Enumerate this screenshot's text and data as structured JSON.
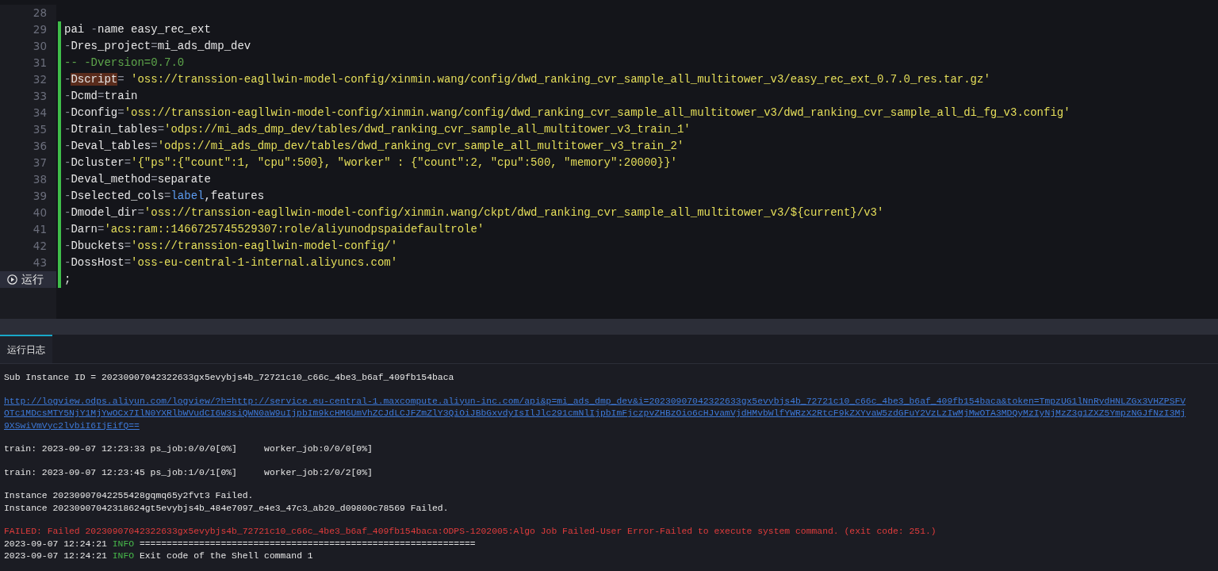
{
  "editor": {
    "lines": [
      {
        "kind": "numbered",
        "number": "28",
        "modified": false
      },
      {
        "kind": "numbered",
        "number": "29",
        "modified": true,
        "tokens": [
          {
            "kind": "plain",
            "text": "pai "
          },
          {
            "kind": "op",
            "text": "-"
          },
          {
            "kind": "plain",
            "text": "name easy_rec_ext"
          }
        ]
      },
      {
        "kind": "numbered",
        "number": "30",
        "modified": true,
        "tokens": [
          {
            "kind": "op",
            "text": "-"
          },
          {
            "kind": "plain",
            "text": "Dres_project"
          },
          {
            "kind": "op",
            "text": "="
          },
          {
            "kind": "plain",
            "text": "mi_ads_dmp_dev"
          }
        ]
      },
      {
        "kind": "numbered",
        "number": "31",
        "modified": true,
        "tokens": [
          {
            "kind": "comment",
            "text": "-- -Dversion=0.7.0"
          }
        ]
      },
      {
        "kind": "numbered",
        "number": "32",
        "modified": true,
        "tokens": [
          {
            "kind": "op",
            "text": "-"
          },
          {
            "kind": "highlight",
            "text": "Dscript"
          },
          {
            "kind": "op",
            "text": "= "
          },
          {
            "kind": "string",
            "text": "'oss://transsion-eagllwin-model-config/xinmin.wang/config/dwd_ranking_cvr_sample_all_multitower_v3/easy_rec_ext_0.7.0_res.tar.gz'"
          }
        ]
      },
      {
        "kind": "numbered",
        "number": "33",
        "modified": true,
        "tokens": [
          {
            "kind": "op",
            "text": "-"
          },
          {
            "kind": "plain",
            "text": "Dcmd"
          },
          {
            "kind": "op",
            "text": "="
          },
          {
            "kind": "plain",
            "text": "train"
          }
        ]
      },
      {
        "kind": "numbered",
        "number": "34",
        "modified": true,
        "tokens": [
          {
            "kind": "op",
            "text": "-"
          },
          {
            "kind": "plain",
            "text": "Dconfig"
          },
          {
            "kind": "op",
            "text": "="
          },
          {
            "kind": "string",
            "text": "'oss://transsion-eagllwin-model-config/xinmin.wang/config/dwd_ranking_cvr_sample_all_multitower_v3/dwd_ranking_cvr_sample_all_di_fg_v3.config'"
          }
        ]
      },
      {
        "kind": "numbered",
        "number": "35",
        "modified": true,
        "tokens": [
          {
            "kind": "op",
            "text": "-"
          },
          {
            "kind": "plain",
            "text": "Dtrain_tables"
          },
          {
            "kind": "op",
            "text": "="
          },
          {
            "kind": "string",
            "text": "'odps://mi_ads_dmp_dev/tables/dwd_ranking_cvr_sample_all_multitower_v3_train_1'"
          }
        ]
      },
      {
        "kind": "numbered",
        "number": "36",
        "modified": true,
        "tokens": [
          {
            "kind": "op",
            "text": "-"
          },
          {
            "kind": "plain",
            "text": "Deval_tables"
          },
          {
            "kind": "op",
            "text": "="
          },
          {
            "kind": "string",
            "text": "'odps://mi_ads_dmp_dev/tables/dwd_ranking_cvr_sample_all_multitower_v3_train_2'"
          }
        ]
      },
      {
        "kind": "numbered",
        "number": "37",
        "modified": true,
        "tokens": [
          {
            "kind": "op",
            "text": "-"
          },
          {
            "kind": "plain",
            "text": "Dcluster"
          },
          {
            "kind": "op",
            "text": "="
          },
          {
            "kind": "string",
            "text": "'{\"ps\":{\"count\":1, \"cpu\":500}, \"worker\" : {\"count\":2, \"cpu\":500, \"memory\":20000}}'"
          }
        ]
      },
      {
        "kind": "numbered",
        "number": "38",
        "modified": true,
        "tokens": [
          {
            "kind": "op",
            "text": "-"
          },
          {
            "kind": "plain",
            "text": "Deval_method"
          },
          {
            "kind": "op",
            "text": "="
          },
          {
            "kind": "plain",
            "text": "separate"
          }
        ]
      },
      {
        "kind": "numbered",
        "number": "39",
        "modified": true,
        "tokens": [
          {
            "kind": "op",
            "text": "-"
          },
          {
            "kind": "plain",
            "text": "Dselected_cols"
          },
          {
            "kind": "op",
            "text": "="
          },
          {
            "kind": "keyword",
            "text": "label"
          },
          {
            "kind": "plain",
            "text": ",features"
          }
        ]
      },
      {
        "kind": "numbered",
        "number": "40",
        "modified": true,
        "tokens": [
          {
            "kind": "op",
            "text": "-"
          },
          {
            "kind": "plain",
            "text": "Dmodel_dir"
          },
          {
            "kind": "op",
            "text": "="
          },
          {
            "kind": "string",
            "text": "'oss://transsion-eagllwin-model-config/xinmin.wang/ckpt/dwd_ranking_cvr_sample_all_multitower_v3/${current}/v3'"
          }
        ]
      },
      {
        "kind": "numbered",
        "number": "41",
        "modified": true,
        "tokens": [
          {
            "kind": "op",
            "text": "-"
          },
          {
            "kind": "plain",
            "text": "Darn"
          },
          {
            "kind": "op",
            "text": "="
          },
          {
            "kind": "string",
            "text": "'acs:ram::1466725745529307:role/aliyunodpspaidefaultrole'"
          }
        ]
      },
      {
        "kind": "numbered",
        "number": "42",
        "modified": true,
        "tokens": [
          {
            "kind": "op",
            "text": "-"
          },
          {
            "kind": "plain",
            "text": "Dbuckets"
          },
          {
            "kind": "op",
            "text": "="
          },
          {
            "kind": "string",
            "text": "'oss://transsion-eagllwin-model-config/'"
          }
        ]
      },
      {
        "kind": "numbered",
        "number": "43",
        "modified": true,
        "tokens": [
          {
            "kind": "op",
            "text": "-"
          },
          {
            "kind": "plain",
            "text": "DossHost"
          },
          {
            "kind": "op",
            "text": "="
          },
          {
            "kind": "string",
            "text": "'oss-eu-central-1-internal.aliyuncs.com'"
          }
        ]
      },
      {
        "kind": "run",
        "label": "运行",
        "modified": true,
        "tokens": [
          {
            "kind": "plain",
            "text": ";"
          }
        ]
      }
    ]
  },
  "log_panel": {
    "tabs": [
      {
        "label": "运行日志",
        "selected": true
      }
    ],
    "blocks": [
      [
        {
          "kind": "text",
          "text": "Sub Instance ID = 20230907042322633gx5evybjs4b_72721c10_c66c_4be3_b6af_409fb154baca"
        }
      ],
      [
        {
          "kind": "link",
          "text": "http://logview.odps.aliyun.com/logview/?h=http://service.eu-central-1.maxcompute.aliyun-inc.com/api&p=mi_ads_dmp_dev&i=20230907042322633gx5evybjs4b_72721c10_c66c_4be3_b6af_409fb154baca&token=TmpzUG1lNnRydHNLZGx3VHZPSFV"
        },
        {
          "kind": "link",
          "text": "OTc1MDcsMTY5NjY1MjYwOCx7IlN0YXRlbWVudCI6W3siQWN0aW9uIjpbIm9kcHM6UmVhZCJdLCJFZmZlY3QiOiJBbGxvdyIsIlJlc291cmNlIjpbImFjczpvZHBzOio6cHJvamVjdHMvbWlfYWRzX2RtcF9kZXYvaW5zdGFuY2VzLzIwMjMwOTA3MDQyMzIyNjMzZ3g1ZXZ5YmpzNGJfNzI3Mj"
        },
        {
          "kind": "link",
          "text": "9XSwiVmVyc2lvbiI6IjEifQ=="
        }
      ],
      [
        {
          "kind": "text",
          "text": "train: 2023-09-07 12:23:33 ps_job:0/0/0[0%]     worker_job:0/0/0[0%]"
        }
      ],
      [
        {
          "kind": "text",
          "text": "train: 2023-09-07 12:23:45 ps_job:1/0/1[0%]     worker_job:2/0/2[0%]"
        }
      ],
      [
        {
          "kind": "text",
          "text": "Instance 20230907042255428gqmq65y2fvt3 Failed."
        },
        {
          "kind": "text",
          "text": "Instance 20230907042318624gt5evybjs4b_484e7097_e4e3_47c3_ab20_d09800c78569 Failed."
        }
      ],
      [
        {
          "kind": "error",
          "text": "FAILED: Failed 20230907042322633gx5evybjs4b_72721c10_c66c_4be3_b6af_409fb154baca:ODPS-1202005:Algo Job Failed-User Error-Failed to execute system command. (exit code: 251.)"
        },
        {
          "kind": "info",
          "time": "2023-09-07 12:24:21",
          "level": "INFO",
          "message": "=============================================================="
        },
        {
          "kind": "info",
          "time": "2023-09-07 12:24:21",
          "level": "INFO",
          "message": "Exit code of the Shell command 1"
        }
      ]
    ]
  }
}
